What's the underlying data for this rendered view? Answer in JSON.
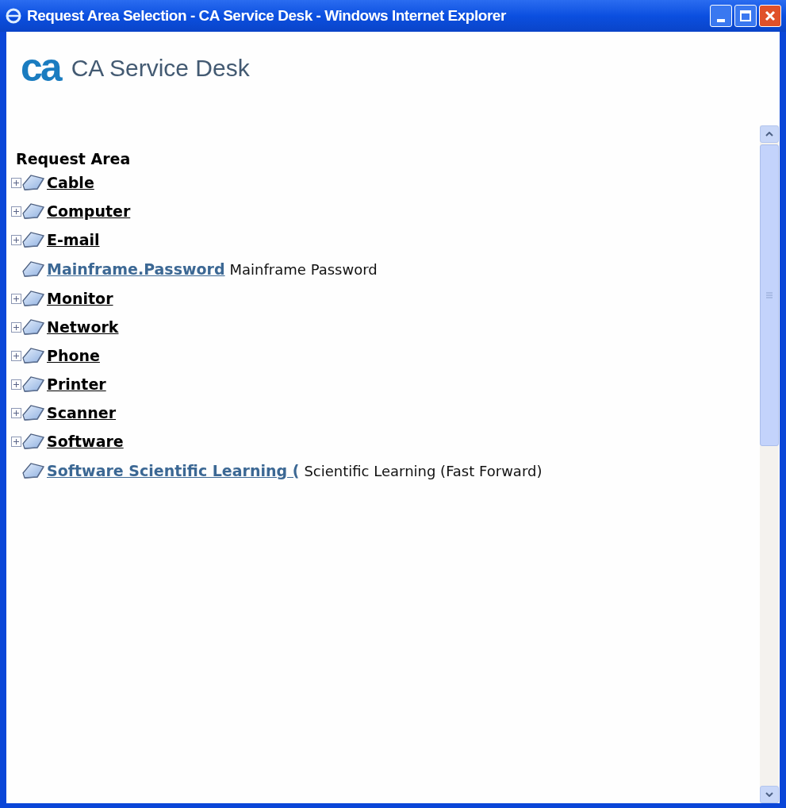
{
  "window": {
    "title": "Request Area Selection - CA Service Desk - Windows Internet Explorer"
  },
  "header": {
    "logo": "ca",
    "title": "CA Service Desk"
  },
  "tree": {
    "heading": "Request Area",
    "items": [
      {
        "kind": "branch",
        "label": "Cable",
        "expanded": false
      },
      {
        "kind": "branch",
        "label": "Computer",
        "expanded": false
      },
      {
        "kind": "branch",
        "label": "E-mail",
        "expanded": false
      },
      {
        "kind": "leaf",
        "label": "Mainframe.Password",
        "description": "Mainframe Password"
      },
      {
        "kind": "branch",
        "label": "Monitor",
        "expanded": false
      },
      {
        "kind": "branch",
        "label": "Network",
        "expanded": false
      },
      {
        "kind": "branch",
        "label": "Phone",
        "expanded": false
      },
      {
        "kind": "branch",
        "label": "Printer",
        "expanded": false
      },
      {
        "kind": "branch",
        "label": "Scanner",
        "expanded": false
      },
      {
        "kind": "branch",
        "label": "Software",
        "expanded": false
      },
      {
        "kind": "leaf",
        "label": "Software Scientific Learning (",
        "description": "Scientific Learning (Fast Forward)"
      }
    ]
  }
}
